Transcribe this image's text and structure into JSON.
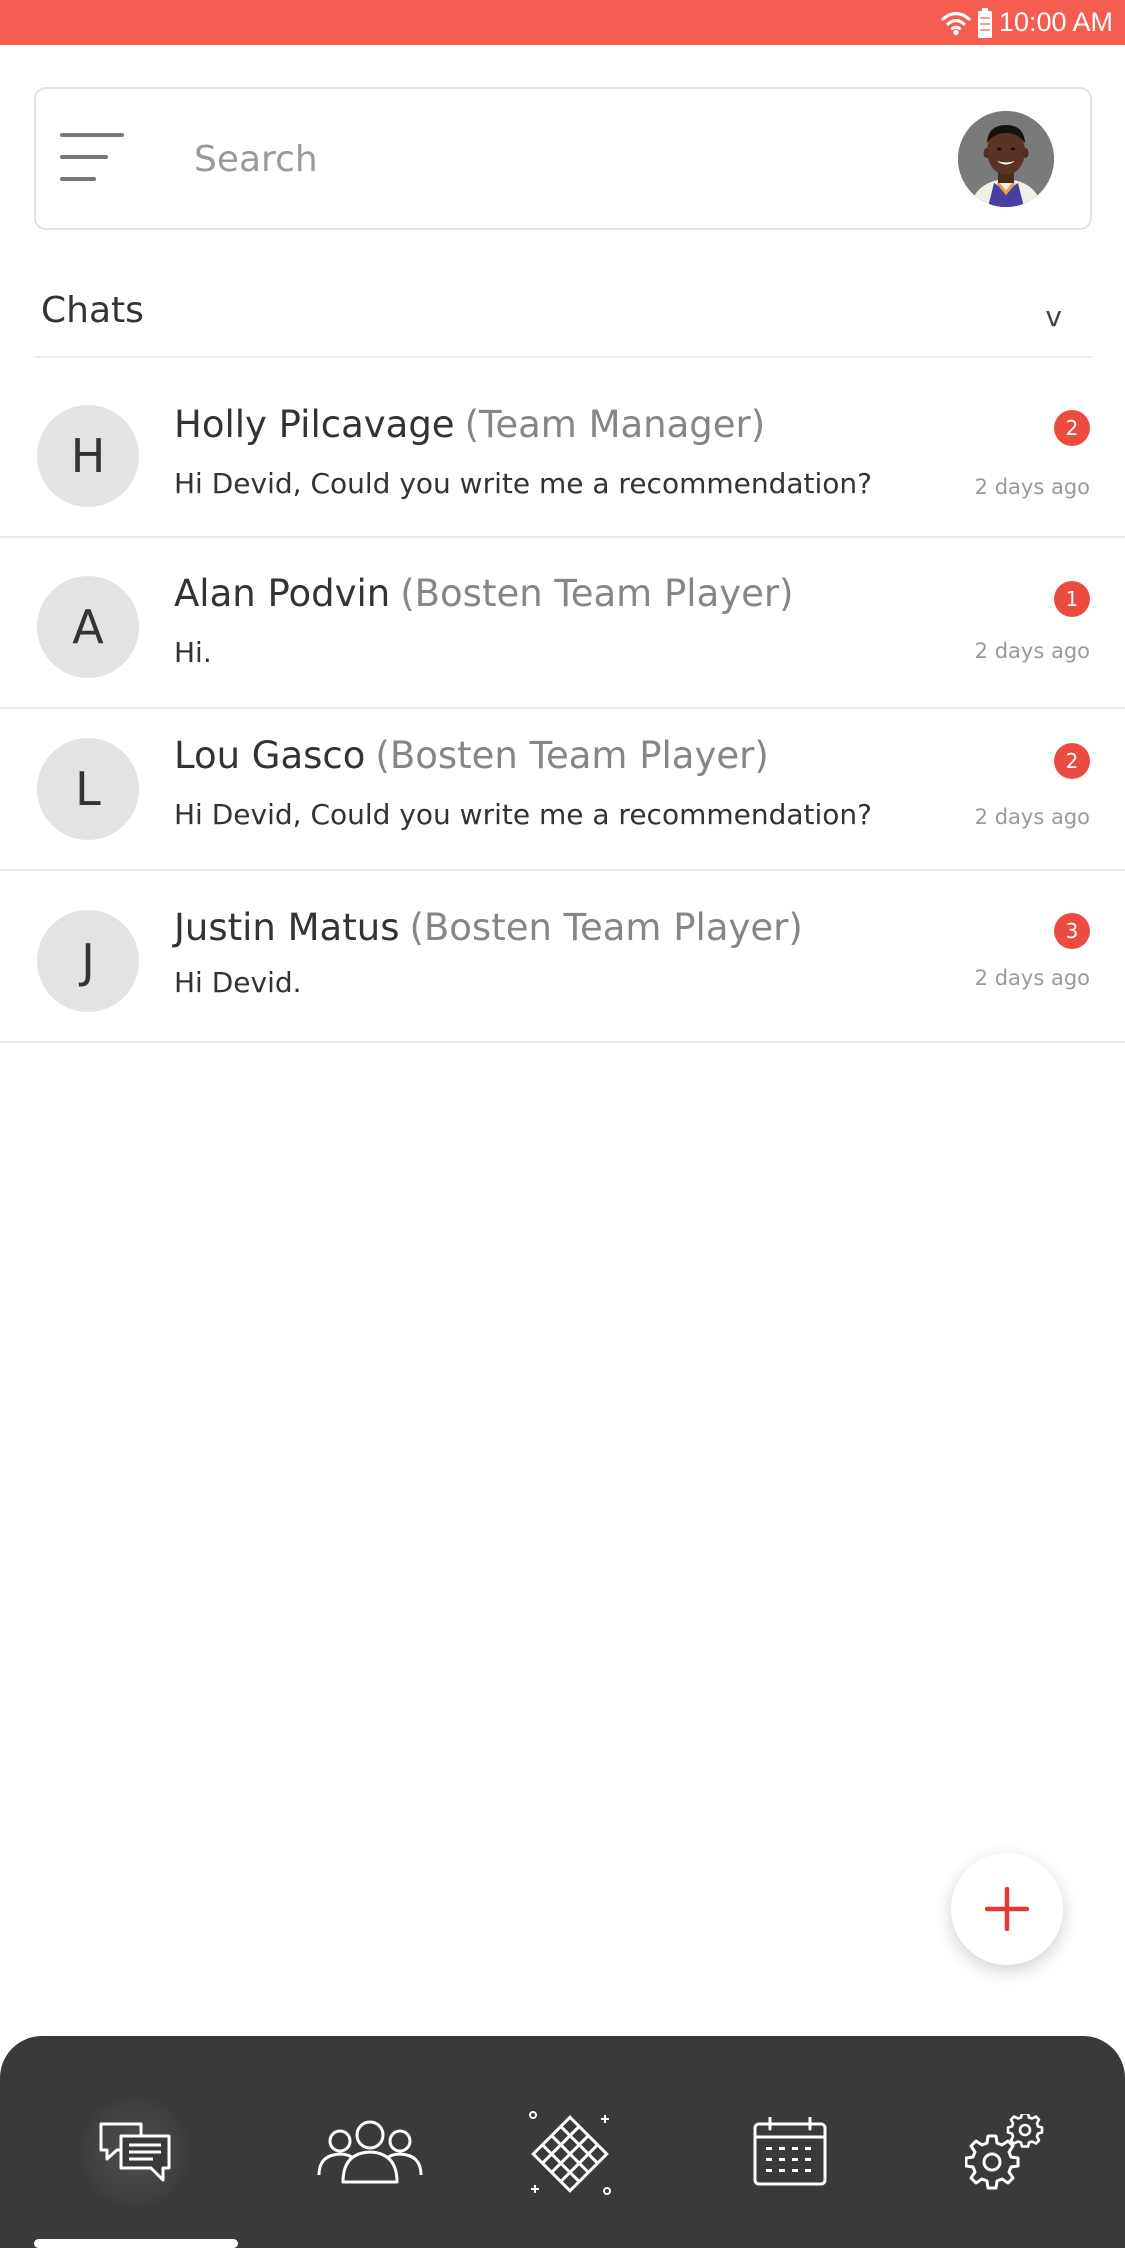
{
  "status_bar": {
    "time": "10:00 AM",
    "icons": [
      "wifi-icon",
      "battery-icon"
    ],
    "background_color": "#f45d50"
  },
  "search": {
    "placeholder": "Search",
    "menu_icon": "hamburger-menu-icon",
    "profile_avatar": "user-profile-photo"
  },
  "chats": {
    "title": "Chats",
    "toggle": "v",
    "items": [
      {
        "initial": "H",
        "name": "Holly Pilcavage",
        "role": "(Team Manager)",
        "message": "Hi Devid, Could you write me a recommendation?",
        "unread": "2",
        "time": "2 days ago"
      },
      {
        "initial": "A",
        "name": "Alan Podvin",
        "role": "(Bosten Team Player)",
        "message": "Hi.",
        "unread": "1",
        "time": "2 days ago"
      },
      {
        "initial": "L",
        "name": "Lou Gasco",
        "role": "(Bosten Team Player)",
        "message": "Hi Devid, Could you write me a recommendation?",
        "unread": "2",
        "time": "2 days ago"
      },
      {
        "initial": "J",
        "name": "Justin Matus",
        "role": "(Bosten Team Player)",
        "message": "Hi Devid.",
        "unread": "3",
        "time": "2 days ago"
      }
    ]
  },
  "fab": {
    "icon": "plus-icon",
    "color": "#e53935"
  },
  "bottom_nav": {
    "items": [
      {
        "icon": "chat-icon",
        "active": true
      },
      {
        "icon": "team-icon",
        "active": false
      },
      {
        "icon": "court-grid-icon",
        "active": false
      },
      {
        "icon": "calendar-icon",
        "active": false
      },
      {
        "icon": "settings-icon",
        "active": false
      }
    ],
    "background_color": "#3a3a3a"
  },
  "colors": {
    "accent": "#f45d50",
    "badge": "#ec4b40",
    "text_primary": "#333333",
    "text_secondary": "#868686"
  }
}
